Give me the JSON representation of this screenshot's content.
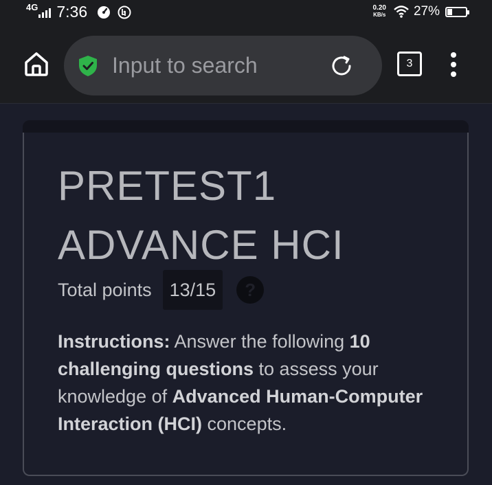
{
  "status_bar": {
    "network": "4G",
    "time": "7:36",
    "speed_value": "0.20",
    "speed_unit": "KB/s",
    "battery_percent": "27%",
    "battery_level": 0.27,
    "icons": [
      "signal-icon",
      "timer-icon",
      "data-saver-icon",
      "wifi-icon",
      "battery-icon"
    ]
  },
  "browser": {
    "address_placeholder": "Input to search",
    "tab_count": "3",
    "icons": [
      "home-icon",
      "shield-check-icon",
      "reload-icon",
      "more-vert-icon"
    ],
    "shield_color": "#2fb34a"
  },
  "form": {
    "title": "PRETEST1 ADVANCE HCI",
    "points_label": "Total points",
    "score": "13/15",
    "help_symbol": "?",
    "instructions": {
      "label": "Instructions:",
      "text_1": " Answer the following ",
      "bold_1": "10 challenging questions",
      "text_2": " to assess your knowledge of ",
      "bold_2": "Advanced Human-Computer Interaction (HCI)",
      "text_3": " concepts."
    }
  }
}
